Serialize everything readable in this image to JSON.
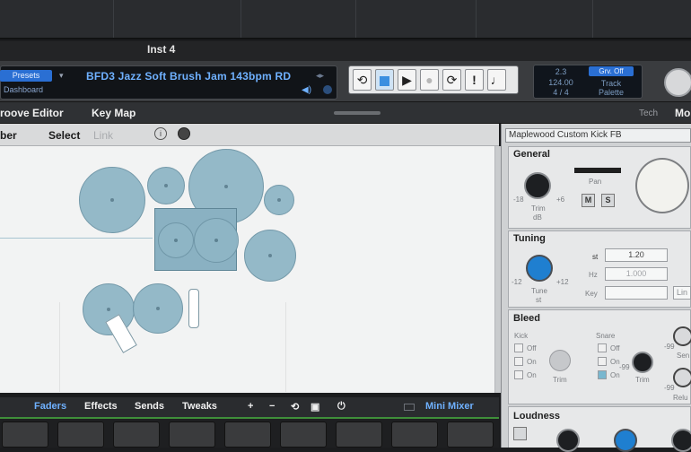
{
  "window": {
    "instrument_title": "Inst 4"
  },
  "preset": {
    "presets_label": "Presets",
    "dashboard_label": "Dashboard",
    "name": "BFD3 Jazz Soft Brush Jam 143bpm RD"
  },
  "transport": {
    "buttons": [
      "loop-icon",
      "stop-icon",
      "play-icon",
      "record-icon",
      "cycle-icon",
      "alert-icon",
      "metronome-icon"
    ],
    "button_glyphs": [
      "⟲",
      "■",
      "▶",
      "●",
      "⟳",
      "!",
      "♩"
    ]
  },
  "lcd": {
    "bar": "2.3",
    "tempo": "124.00",
    "signature": "4 / 4",
    "grv_label": "Grv. Off",
    "mode_line1": "Track",
    "mode_line2": "Palette"
  },
  "menu": {
    "items": [
      "roove Editor",
      "Key Map"
    ],
    "right_items": [
      "Tech",
      "Mo"
    ]
  },
  "sub_toolbar": {
    "items": [
      "ber",
      "Select",
      "Link"
    ]
  },
  "mixer": {
    "tabs": [
      "Faders",
      "Effects",
      "Sends",
      "Tweaks"
    ],
    "tools": [
      "+",
      "−",
      "⟲",
      "▣",
      "⏻"
    ],
    "mini_mixer_label": "Mini Mixer"
  },
  "right_panel": {
    "kit_piece": "Maplewood Custom Kick FB",
    "general": {
      "title": "General",
      "pan_label": "Pan",
      "trim_label": "Trim",
      "trim_unit": "dB",
      "trim_min": "-18",
      "trim_max": "+6",
      "mute": "M",
      "solo": "S"
    },
    "tuning": {
      "title": "Tuning",
      "st_label": "st",
      "st_value": "1.20",
      "hz_label": "Hz",
      "hz_value": "1.000",
      "key_label": "Key",
      "tune_label": "Tune",
      "tune_unit": "st",
      "tune_min": "-12",
      "tune_max": "+12",
      "link_label": "Lin"
    },
    "bleed": {
      "title": "Bleed",
      "kick_label": "Kick",
      "snare_label": "Snare",
      "options": [
        "Off",
        "On",
        "On"
      ],
      "trim_label": "Trim",
      "knob_min": "-99",
      "sen_label": "Sen",
      "rel_label": "Relu"
    },
    "loudness": {
      "title": "Loudness"
    }
  }
}
